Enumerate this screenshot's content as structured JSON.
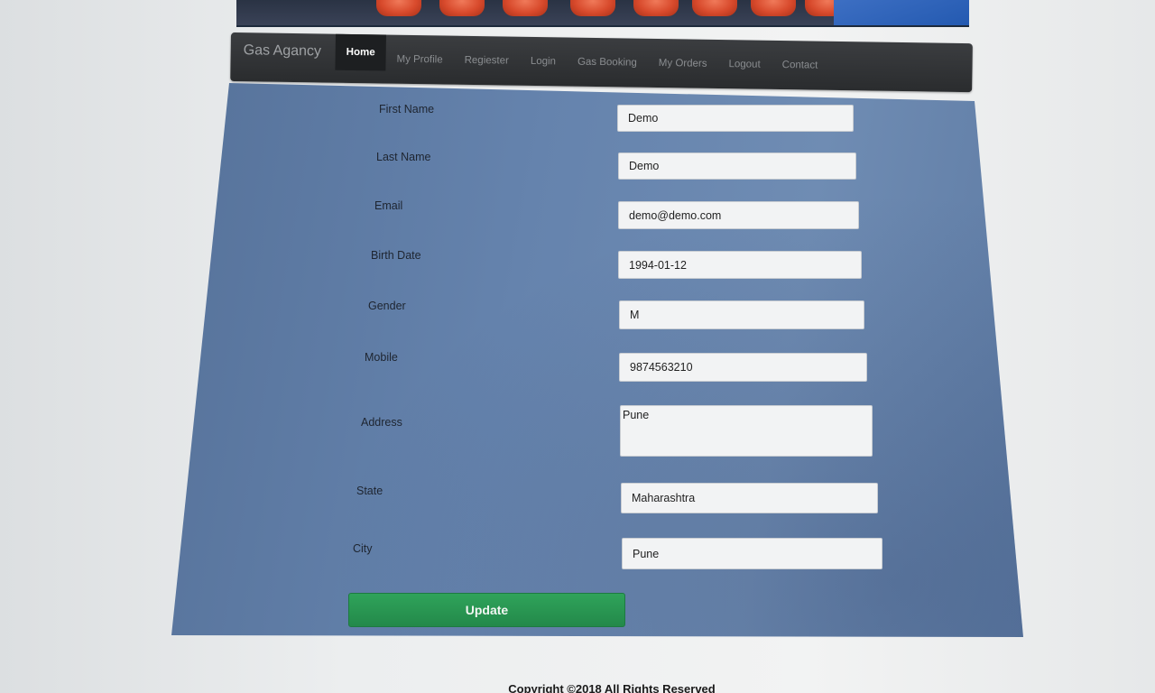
{
  "navbar": {
    "brand": "Gas Agancy",
    "items": [
      {
        "label": "Home",
        "active": true
      },
      {
        "label": "My Profile",
        "active": false
      },
      {
        "label": "Regiester",
        "active": false
      },
      {
        "label": "Login",
        "active": false
      },
      {
        "label": "Gas Booking",
        "active": false
      },
      {
        "label": "My Orders",
        "active": false
      },
      {
        "label": "Logout",
        "active": false
      },
      {
        "label": "Contact",
        "active": false
      }
    ]
  },
  "form": {
    "first_name": {
      "label": "First Name",
      "value": "Demo"
    },
    "last_name": {
      "label": "Last Name",
      "value": "Demo"
    },
    "email": {
      "label": "Email",
      "value": "demo@demo.com"
    },
    "birth_date": {
      "label": "Birth Date",
      "value": "1994-01-12"
    },
    "gender": {
      "label": "Gender",
      "value": "M"
    },
    "mobile": {
      "label": "Mobile",
      "value": "9874563210"
    },
    "address": {
      "label": "Address",
      "value": "Pune"
    },
    "state": {
      "label": "State",
      "value": "Maharashtra"
    },
    "city": {
      "label": "City",
      "value": "Pune"
    },
    "update_label": "Update"
  },
  "footer": {
    "copyright": "Copyright ©2018 All Rights Reserved"
  },
  "colors": {
    "navbar_bg": "#2f3133",
    "panel_bg": "#6583ad",
    "update_button": "#2a9a55"
  }
}
